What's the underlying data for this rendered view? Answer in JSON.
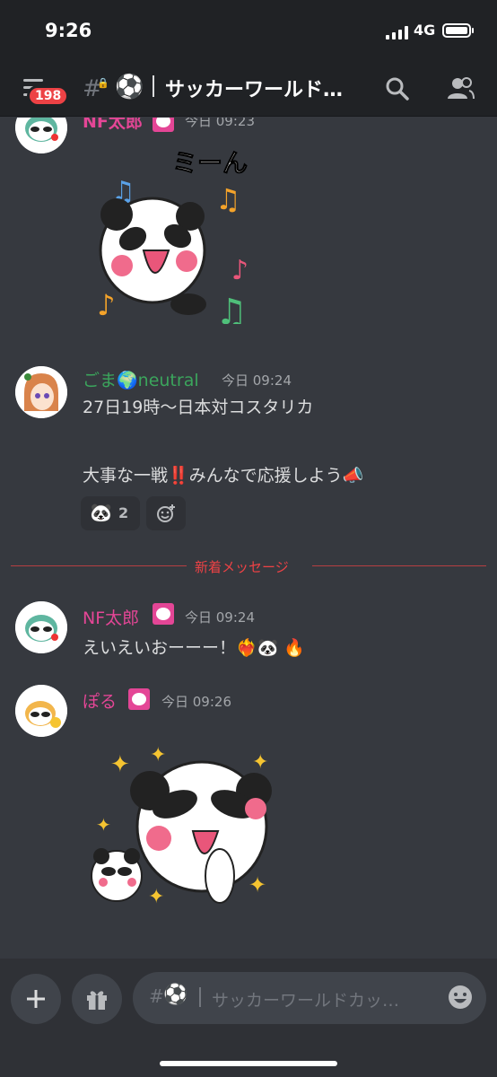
{
  "status": {
    "time": "9:26",
    "network": "4G",
    "battery_level": 0.9
  },
  "header": {
    "badge": "198",
    "channel_prefix": "#",
    "channel_emoji": "⚽",
    "channel_name": "サッカーワールド…"
  },
  "messages": [
    {
      "author": "NF太郎",
      "time": "今日 09:23",
      "sticker_text": "ミーん"
    },
    {
      "author": "ごま🌍neutral",
      "time": "今日 09:24",
      "line1": "27日19時〜日本対コスタリカ",
      "line2": "大事な一戦‼️みんなで応援しよう📣",
      "reaction_count": "2"
    },
    {
      "author": "NF太郎",
      "time": "今日 09:24",
      "text": "えいえいおーーー！❤️‍🔥🐼 🔥"
    },
    {
      "author": "ぽる",
      "time": "今日 09:26"
    }
  ],
  "divider": {
    "label": "新着メッセージ"
  },
  "composer": {
    "placeholder": "サッカーワールドカッ…",
    "channel_emoji": "⚽"
  },
  "colors": {
    "pink": "#e44696",
    "green": "#3ba55c",
    "red": "#ed4245"
  }
}
